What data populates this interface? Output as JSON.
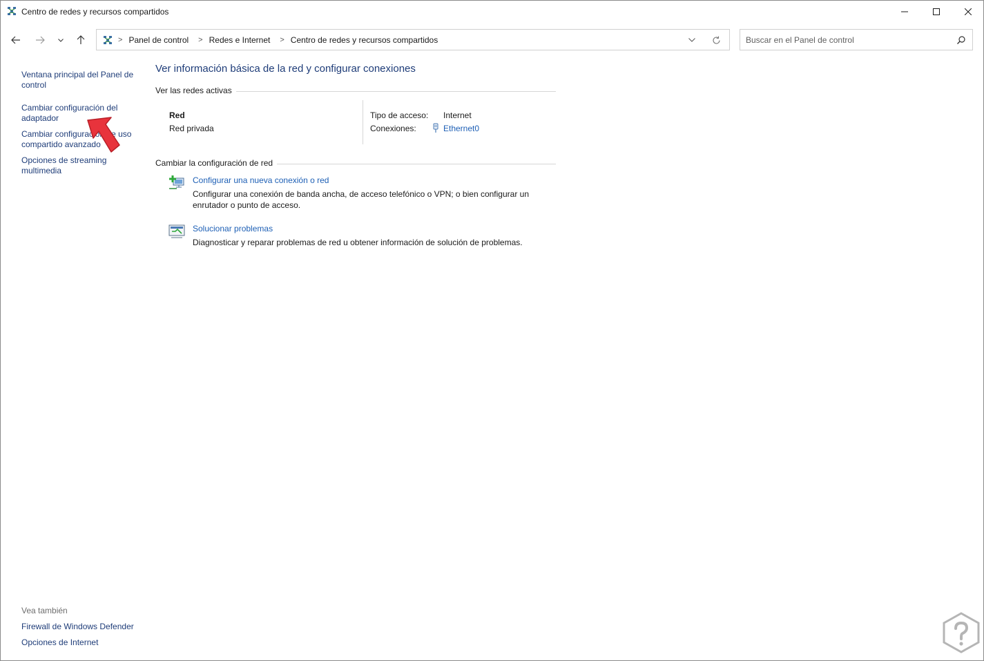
{
  "window": {
    "title": "Centro de redes y recursos compartidos"
  },
  "address": {
    "breadcrumbs": [
      "Panel de control",
      "Redes e Internet",
      "Centro de redes y recursos compartidos"
    ],
    "separator": ">"
  },
  "search": {
    "placeholder": "Buscar en el Panel de control",
    "value": ""
  },
  "sidebar": {
    "items": [
      {
        "label_line1": "Ventana principal del Panel de",
        "label_line2": "control"
      },
      {
        "label_line1": "Cambiar configuración del",
        "label_line2": "adaptador"
      },
      {
        "label_line1": "Cambiar configuración de uso",
        "label_line2": "compartido avanzado"
      },
      {
        "label_line1": "Opciones de streaming",
        "label_line2": "multimedia"
      }
    ],
    "see_also": {
      "heading": "Vea también",
      "items": [
        "Firewall de Windows Defender",
        "Opciones de Internet"
      ]
    }
  },
  "main": {
    "title": "Ver información básica de la red y configurar conexiones",
    "active_networks": {
      "heading": "Ver las redes activas",
      "network_name": "Red",
      "network_category": "Red privada",
      "access_type_label": "Tipo de acceso:",
      "access_type_value": "Internet",
      "connections_label": "Conexiones:",
      "connections_value": "Ethernet0"
    },
    "change_settings": {
      "heading": "Cambiar la configuración de red",
      "tasks": [
        {
          "title": "Configurar una nueva conexión o red",
          "desc_line1": "Configurar una conexión de banda ancha, de acceso telefónico o VPN; o bien configurar un",
          "desc_line2": "enrutador o punto de acceso."
        },
        {
          "title": "Solucionar problemas",
          "desc_line1": "Diagnosticar y reparar problemas de red u obtener información de solución de problemas."
        }
      ]
    }
  },
  "colors": {
    "link": "#1d5fb5",
    "sidebar_link": "#1e3c78",
    "title": "#1e3c78",
    "arrow": "#e8333c"
  }
}
